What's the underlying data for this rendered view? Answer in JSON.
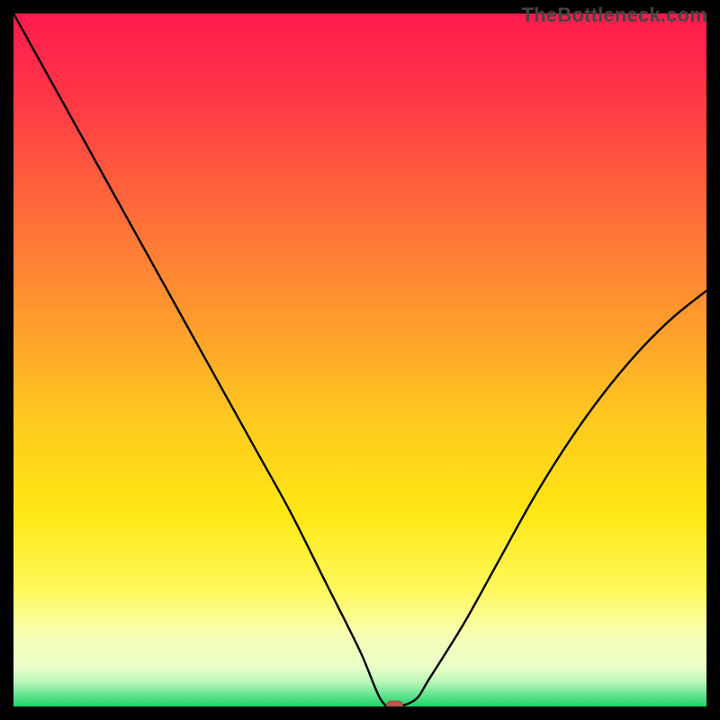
{
  "watermark": "TheBottleneck.com",
  "colors": {
    "frame": "#000000",
    "gradient_stops": [
      {
        "offset": 0.0,
        "color": "#ff1a4d"
      },
      {
        "offset": 0.12,
        "color": "#ff3647"
      },
      {
        "offset": 0.28,
        "color": "#ff6a3a"
      },
      {
        "offset": 0.44,
        "color": "#ff9a2e"
      },
      {
        "offset": 0.58,
        "color": "#ffc820"
      },
      {
        "offset": 0.72,
        "color": "#ffe714"
      },
      {
        "offset": 0.83,
        "color": "#fff85a"
      },
      {
        "offset": 0.9,
        "color": "#f6ffb8"
      },
      {
        "offset": 0.945,
        "color": "#e7ffc8"
      },
      {
        "offset": 0.965,
        "color": "#b9f6b8"
      },
      {
        "offset": 0.985,
        "color": "#5be289"
      },
      {
        "offset": 1.0,
        "color": "#1dd468"
      }
    ],
    "curve": "#000000",
    "marker": "#b35a4a"
  },
  "chart_data": {
    "type": "line",
    "title": "",
    "xlabel": "",
    "ylabel": "",
    "xlim": [
      0,
      100
    ],
    "ylim": [
      0,
      100
    ],
    "grid": false,
    "legend": false,
    "series": [
      {
        "name": "bottleneck-curve",
        "x": [
          0,
          5,
          10,
          15,
          20,
          25,
          30,
          35,
          40,
          45,
          50,
          53,
          55,
          58,
          60,
          65,
          70,
          75,
          80,
          85,
          90,
          95,
          100
        ],
        "values": [
          100,
          91,
          82,
          73,
          64,
          55,
          46,
          37,
          28,
          18,
          8,
          1,
          0,
          1,
          4,
          12,
          21,
          30,
          38,
          45,
          51,
          56,
          60
        ]
      }
    ],
    "annotations": [
      {
        "name": "optimum-marker",
        "x": 55,
        "y": 0,
        "shape": "rounded-rect"
      }
    ]
  }
}
